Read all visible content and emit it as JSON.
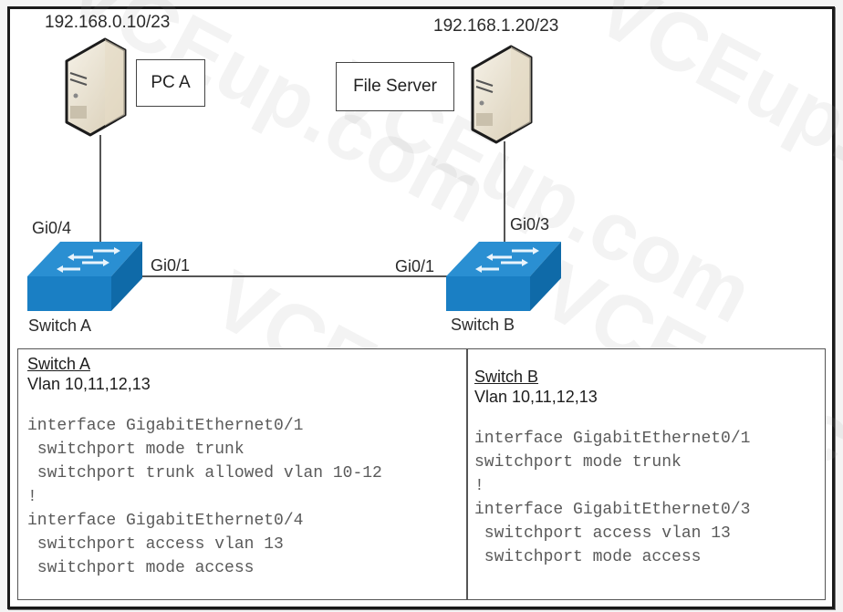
{
  "diagram": {
    "pc_a": {
      "ip": "192.168.0.10/23",
      "label": "PC A",
      "icon": "pc-tower-icon"
    },
    "file_server": {
      "ip": "192.168.1.20/23",
      "label": "File Server",
      "icon": "server-tower-icon"
    },
    "switch_a": {
      "name": "Switch A",
      "icon": "switch-icon",
      "access_port": "Gi0/4",
      "uplink_port": "Gi0/1"
    },
    "switch_b": {
      "name": "Switch B",
      "icon": "switch-icon",
      "access_port": "Gi0/3",
      "uplink_port": "Gi0/1"
    },
    "colors": {
      "switch_blue": "#1a7fc4",
      "switch_top": "#2a8fd2",
      "switch_side": "#0f6aa8",
      "computer_beige": "#ebe4d3"
    }
  },
  "config": {
    "switch_a": {
      "title": "Switch A",
      "vlans": "Vlan 10,11,12,13",
      "lines": [
        "interface GigabitEthernet0/1",
        " switchport mode trunk",
        " switchport trunk allowed vlan 10-12",
        "!",
        "interface GigabitEthernet0/4",
        " switchport access vlan 13",
        " switchport mode access"
      ]
    },
    "switch_b": {
      "title": "Switch B",
      "vlans": "Vlan 10,11,12,13",
      "lines": [
        "interface GigabitEthernet0/1",
        "switchport mode trunk",
        "!",
        "interface GigabitEthernet0/3",
        " switchport access vlan 13",
        " switchport mode access"
      ]
    }
  },
  "watermark": "VCEup.com"
}
